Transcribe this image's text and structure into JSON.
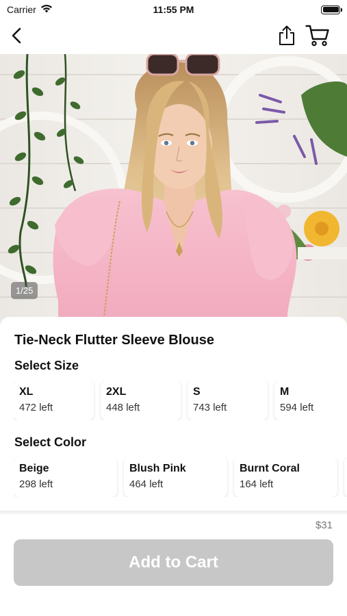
{
  "status_bar": {
    "carrier": "Carrier",
    "time": "11:55 PM"
  },
  "nav": {
    "back_icon": "chevron-left-icon",
    "share_icon": "share-icon",
    "cart_icon": "cart-icon"
  },
  "hero": {
    "photo_counter": "1/25"
  },
  "product": {
    "title": "Tie-Neck Flutter Sleeve Blouse",
    "size_label": "Select Size",
    "sizes": [
      {
        "name": "XL",
        "stock": "472 left"
      },
      {
        "name": "2XL",
        "stock": "448 left"
      },
      {
        "name": "S",
        "stock": "743 left"
      },
      {
        "name": "M",
        "stock": "594 left"
      }
    ],
    "color_label": "Select Color",
    "colors": [
      {
        "name": "Beige",
        "stock": "298 left"
      },
      {
        "name": "Blush Pink",
        "stock": "464 left"
      },
      {
        "name": "Burnt Coral",
        "stock": "164 left"
      }
    ],
    "price": "$31",
    "add_to_cart_label": "Add to Cart"
  },
  "colors": {
    "button_disabled": "#c7c7c7",
    "blouse": "#f4b8c8",
    "text": "#111111"
  }
}
